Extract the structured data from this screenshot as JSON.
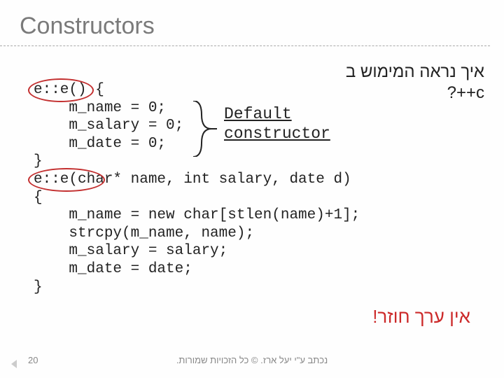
{
  "title": "Constructors",
  "hebrew_question_line1": "איך נראה המימוש ב",
  "hebrew_question_line2": "c++?",
  "code": "e::e() {\n    m_name = 0;\n    m_salary = 0;\n    m_date = 0;\n}\ne::e(char* name, int salary, date d)\n{\n    m_name = new char[stlen(name)+1];\n    strcpy(m_name, name);\n    m_salary = salary;\n    m_date = date;\n}",
  "default_label_line1": "Default",
  "default_label_line2": "constructor",
  "no_return": "אין ערך חוזר!",
  "page_number": "20",
  "footer_text": "נכתב ע\"י יעל ארז. © כל הזכויות שמורות."
}
